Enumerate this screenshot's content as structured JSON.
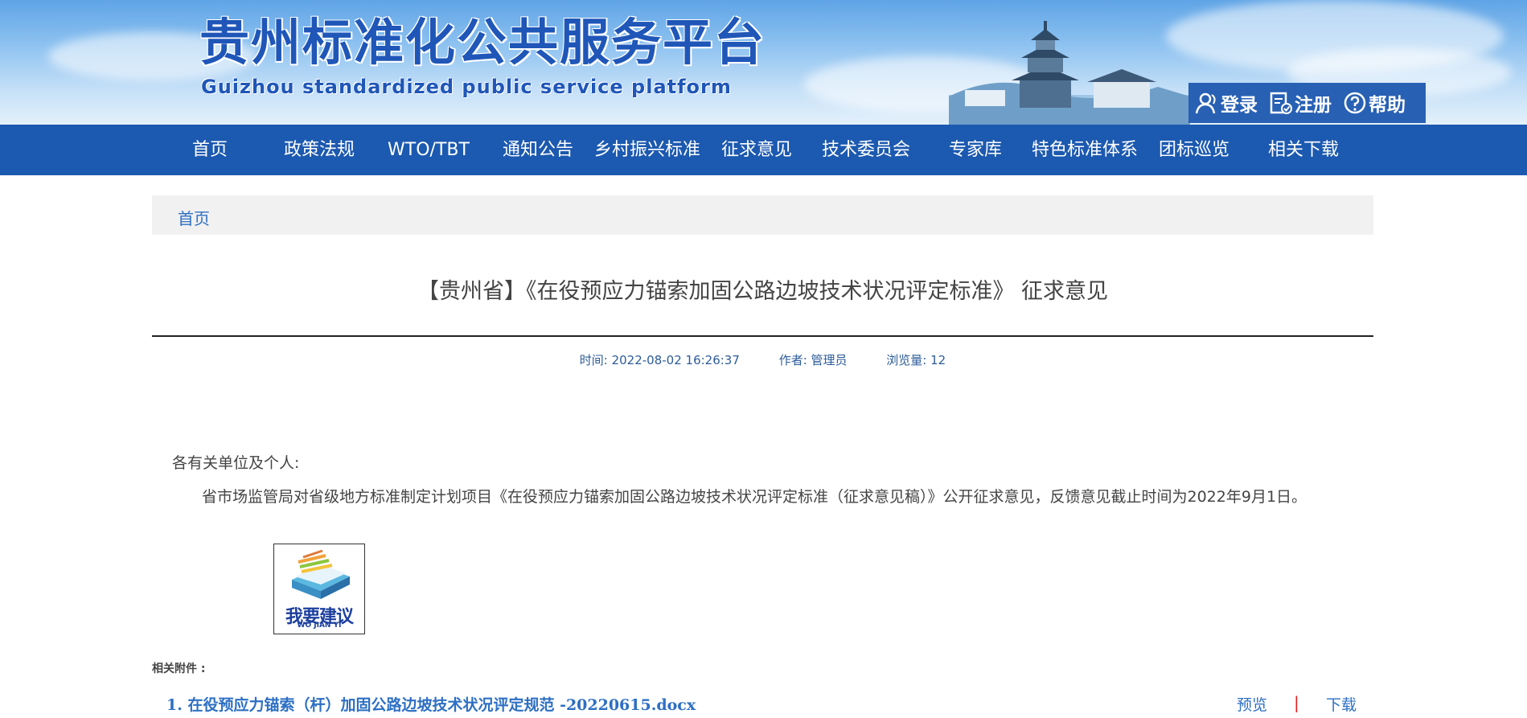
{
  "header": {
    "title": "贵州标准化公共服务平台",
    "subtitle": "Guizhou standardized public service platform",
    "user_links": [
      {
        "label": "登录",
        "icon": "user-icon"
      },
      {
        "label": "注册",
        "icon": "register-icon"
      },
      {
        "label": "帮助",
        "icon": "help-icon"
      }
    ]
  },
  "nav": {
    "items": [
      "首页",
      "政策法规",
      "WTO/TBT",
      "通知公告",
      "乡村振兴标准",
      "征求意见",
      "技术委员会",
      "专家库",
      "特色标准体系",
      "团标巡览",
      "相关下载"
    ]
  },
  "breadcrumb": {
    "home": "首页"
  },
  "article": {
    "title": "【贵州省】《在役预应力锚索加固公路边坡技术状况评定标准》 征求意见",
    "meta": {
      "time": "时间: 2022-08-02 16:26:37",
      "author": "作者:  管理员",
      "views": "浏览量: 12"
    },
    "salutation": "各有关单位及个人:",
    "body": "省市场监管局对省级地方标准制定计划项目《在役预应力锚索加固公路边坡技术状况评定标准（征求意见稿）》公开征求意见，反馈意见截止时间为2022年9月1日。",
    "suggest_button": {
      "text": "我要建议",
      "pinyin": "WO JIAN YI"
    }
  },
  "attachments": {
    "label": "相关附件 :",
    "items": [
      {
        "name": "1.  在役预应力锚索（杆）加固公路边坡技术状况评定规范 -20220615.docx",
        "preview": "预览",
        "separator": "|",
        "download": "下载"
      }
    ]
  },
  "colors": {
    "nav_bg": "#1c59b0",
    "brand_blue": "#1f56b8",
    "link_blue": "#2d6fc4",
    "separator_red": "#e02020"
  }
}
